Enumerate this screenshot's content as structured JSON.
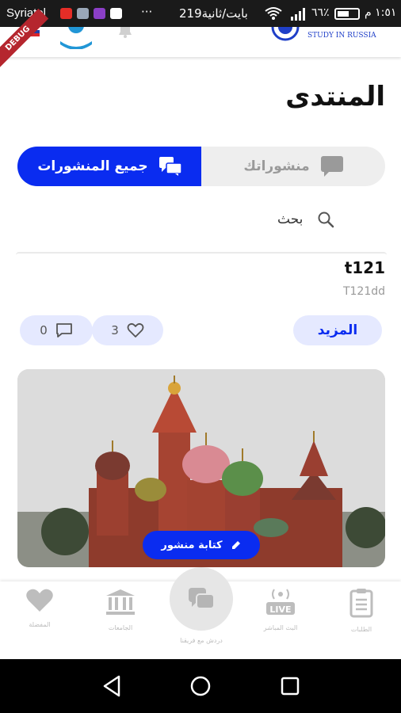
{
  "status_bar": {
    "carrier": "Syriatel",
    "more_dots": "···",
    "speed": "219بايت/ثانية",
    "battery": "٦٦٪",
    "time": "١:٥١ م"
  },
  "app_bar": {
    "logo_text": "STUDY IN RUSSIA",
    "ribbon": "DEBUG"
  },
  "page": {
    "title": "المنتدى"
  },
  "segment": {
    "active_label": "جميع المنشورات",
    "inactive_label": "منشوراتك"
  },
  "search": {
    "label": "بحث"
  },
  "post": {
    "title": "t121",
    "subtitle": "T121dd",
    "more_label": "المزيد",
    "likes": "3",
    "comments": "0"
  },
  "write_post": {
    "label": "كتابة منشور"
  },
  "bottom_nav": {
    "favorites": "المفضلة",
    "universities": "الجامعات",
    "chat_team": "دردش مع فريقنا",
    "live": "البث المباشر",
    "requests": "الطلبات"
  },
  "colors": {
    "accent": "#0a2cf0",
    "accent_light": "#e5e9ff"
  }
}
